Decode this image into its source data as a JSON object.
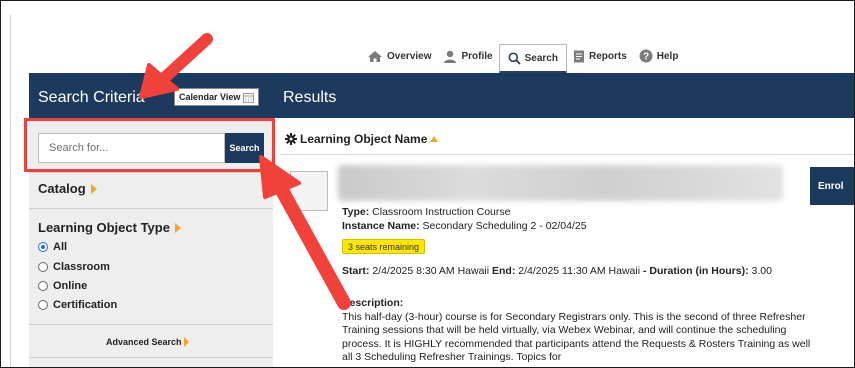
{
  "nav": {
    "items": [
      {
        "label": "Overview",
        "icon": "home-icon"
      },
      {
        "label": "Profile",
        "icon": "user-icon"
      },
      {
        "label": "Search",
        "icon": "search-icon",
        "active": true
      },
      {
        "label": "Reports",
        "icon": "document-icon"
      },
      {
        "label": "Help",
        "icon": "help-icon"
      }
    ]
  },
  "header": {
    "search_criteria": "Search Criteria",
    "calendar_view": "Calendar View",
    "results": "Results"
  },
  "search": {
    "placeholder": "Search for...",
    "button_label": "Search"
  },
  "left_panel": {
    "catalog": "Catalog",
    "learning_object_type": "Learning Object Type",
    "options": [
      {
        "label": "All",
        "checked": true
      },
      {
        "label": "Classroom",
        "checked": false
      },
      {
        "label": "Online",
        "checked": false
      },
      {
        "label": "Certification",
        "checked": false
      }
    ],
    "advanced_search": "Advanced Search"
  },
  "results": {
    "sort_header": "Learning Object Name",
    "enroll": "Enrol",
    "item": {
      "type_label": "Type:",
      "type_value": "Classroom Instruction Course",
      "instance_label": "Instance Name:",
      "instance_value": "Secondary Scheduling 2 - 02/04/25",
      "seats": "3 seats remaining",
      "start_label": "Start:",
      "start_value": "2/4/2025 8:30 AM Hawaii",
      "end_label": "End:",
      "end_value": "2/4/2025 11:30 AM Hawaii",
      "duration_label": "- Duration (in Hours):",
      "duration_value": "3.00",
      "description_label": "Description:",
      "description_text": "This half-day (3-hour) course is for Secondary Registrars only. This is the second of three Refresher Training sessions that will be held virtually, via Webex Webinar, and will continue the scheduling process. It is HIGHLY recommended that participants attend the Requests & Rosters Training as well all 3 Scheduling Refresher Trainings. Topics for"
    }
  },
  "colors": {
    "header_bg": "#1c3a5e",
    "accent_orange": "#f5a623",
    "highlight_red": "#f0423a",
    "seats_yellow": "#ffe600"
  }
}
